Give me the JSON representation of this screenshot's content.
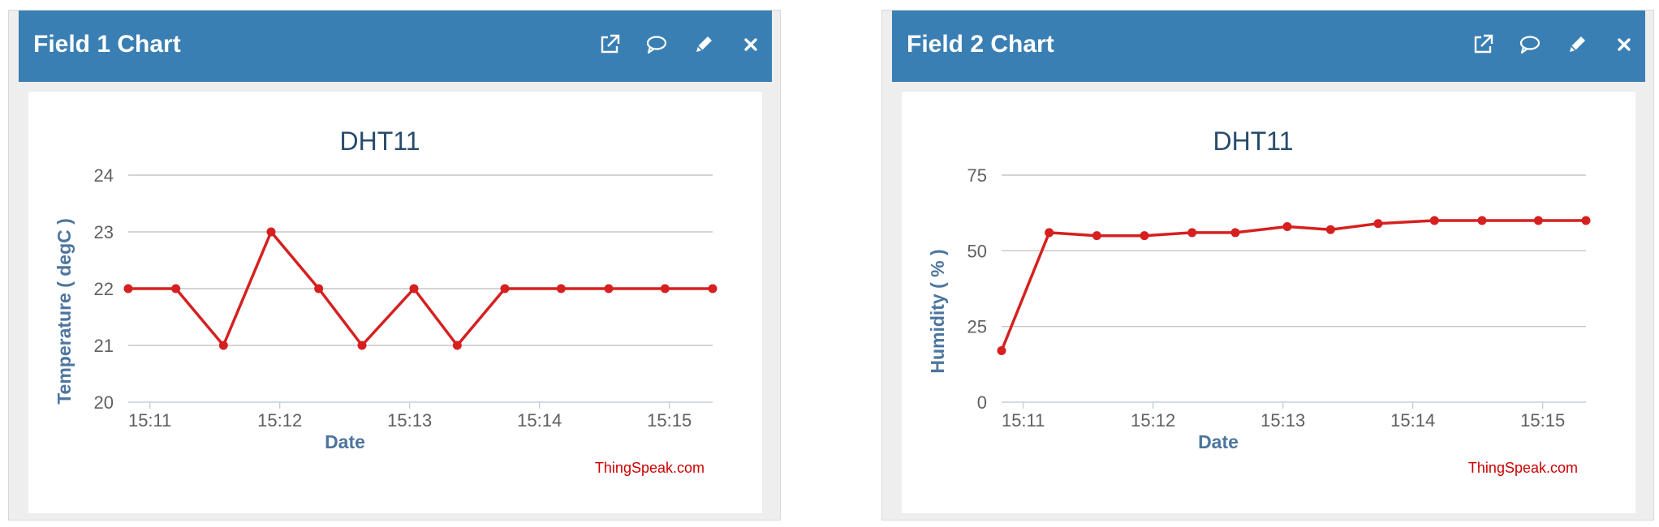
{
  "icons": [
    "external-link-icon",
    "comment-icon",
    "edit-icon",
    "close-icon"
  ],
  "colors": {
    "header": "#3a7fb3",
    "series": "#d62020",
    "axis_label": "#4d759e",
    "title": "#274b6d"
  },
  "panels": [
    {
      "title": "Field 1 Chart",
      "chart": {
        "title": "DHT11",
        "ylabel": "Temperature ( degC )",
        "xlabel": "Date",
        "credit": "ThingSpeak.com",
        "yticks": [
          "20",
          "21",
          "22",
          "23",
          "24"
        ],
        "xticks": [
          "15:11",
          "15:12",
          "15:13",
          "15:14",
          "15:15"
        ]
      }
    },
    {
      "title": "Field 2 Chart",
      "chart": {
        "title": "DHT11",
        "ylabel": "Humidity ( % )",
        "xlabel": "Date",
        "credit": "ThingSpeak.com",
        "yticks": [
          "0",
          "25",
          "50",
          "75"
        ],
        "xticks": [
          "15:11",
          "15:12",
          "15:13",
          "15:14",
          "15:15"
        ]
      }
    }
  ],
  "chart_data": [
    {
      "type": "line",
      "title": "DHT11",
      "xlabel": "Date",
      "ylabel": "Temperature ( degC )",
      "ylim": [
        20,
        24
      ],
      "yticks": [
        20,
        21,
        22,
        23,
        24
      ],
      "xticks": [
        "15:11",
        "15:12",
        "15:13",
        "15:14",
        "15:15"
      ],
      "x": [
        "15:10:50",
        "15:11:12",
        "15:11:34",
        "15:11:56",
        "15:12:18",
        "15:12:38",
        "15:13:02",
        "15:13:22",
        "15:13:44",
        "15:14:10",
        "15:14:32",
        "15:14:58",
        "15:15:20"
      ],
      "values": [
        22,
        22,
        21,
        23,
        22,
        21,
        22,
        21,
        22,
        22,
        22,
        22,
        22
      ],
      "grid": true
    },
    {
      "type": "line",
      "title": "DHT11",
      "xlabel": "Date",
      "ylabel": "Humidity ( % )",
      "ylim": [
        0,
        75
      ],
      "yticks": [
        0,
        25,
        50,
        75
      ],
      "xticks": [
        "15:11",
        "15:12",
        "15:13",
        "15:14",
        "15:15"
      ],
      "x": [
        "15:10:50",
        "15:11:12",
        "15:11:34",
        "15:11:56",
        "15:12:18",
        "15:12:38",
        "15:13:02",
        "15:13:22",
        "15:13:44",
        "15:14:10",
        "15:14:32",
        "15:14:58",
        "15:15:20"
      ],
      "values": [
        17,
        56,
        55,
        55,
        56,
        56,
        58,
        57,
        59,
        60,
        60,
        60,
        60
      ],
      "grid": true
    }
  ]
}
